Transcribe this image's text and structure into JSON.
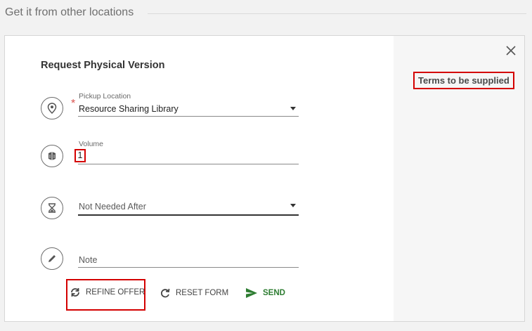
{
  "section": {
    "heading": "Get it from other locations"
  },
  "form": {
    "title": "Request Physical Version",
    "pickup": {
      "label": "Pickup Location",
      "value": "Resource Sharing Library",
      "required_mark": "*"
    },
    "volume": {
      "label": "Volume",
      "value": "1"
    },
    "not_needed_after": {
      "placeholder": "Not Needed After"
    },
    "note": {
      "placeholder": "Note"
    }
  },
  "sidebar": {
    "terms": "Terms to be supplied"
  },
  "actions": {
    "refine_label": "REFINE OFFER",
    "reset_label": "RESET FORM",
    "send_label": "SEND"
  },
  "colors": {
    "highlight": "#d40000",
    "send": "#2e7d32",
    "required": "#d9534f"
  },
  "icons": [
    "map-pin-icon",
    "book-icon",
    "hourglass-icon",
    "pencil-icon",
    "close-icon",
    "refresh-icon",
    "reset-icon",
    "send-icon"
  ]
}
